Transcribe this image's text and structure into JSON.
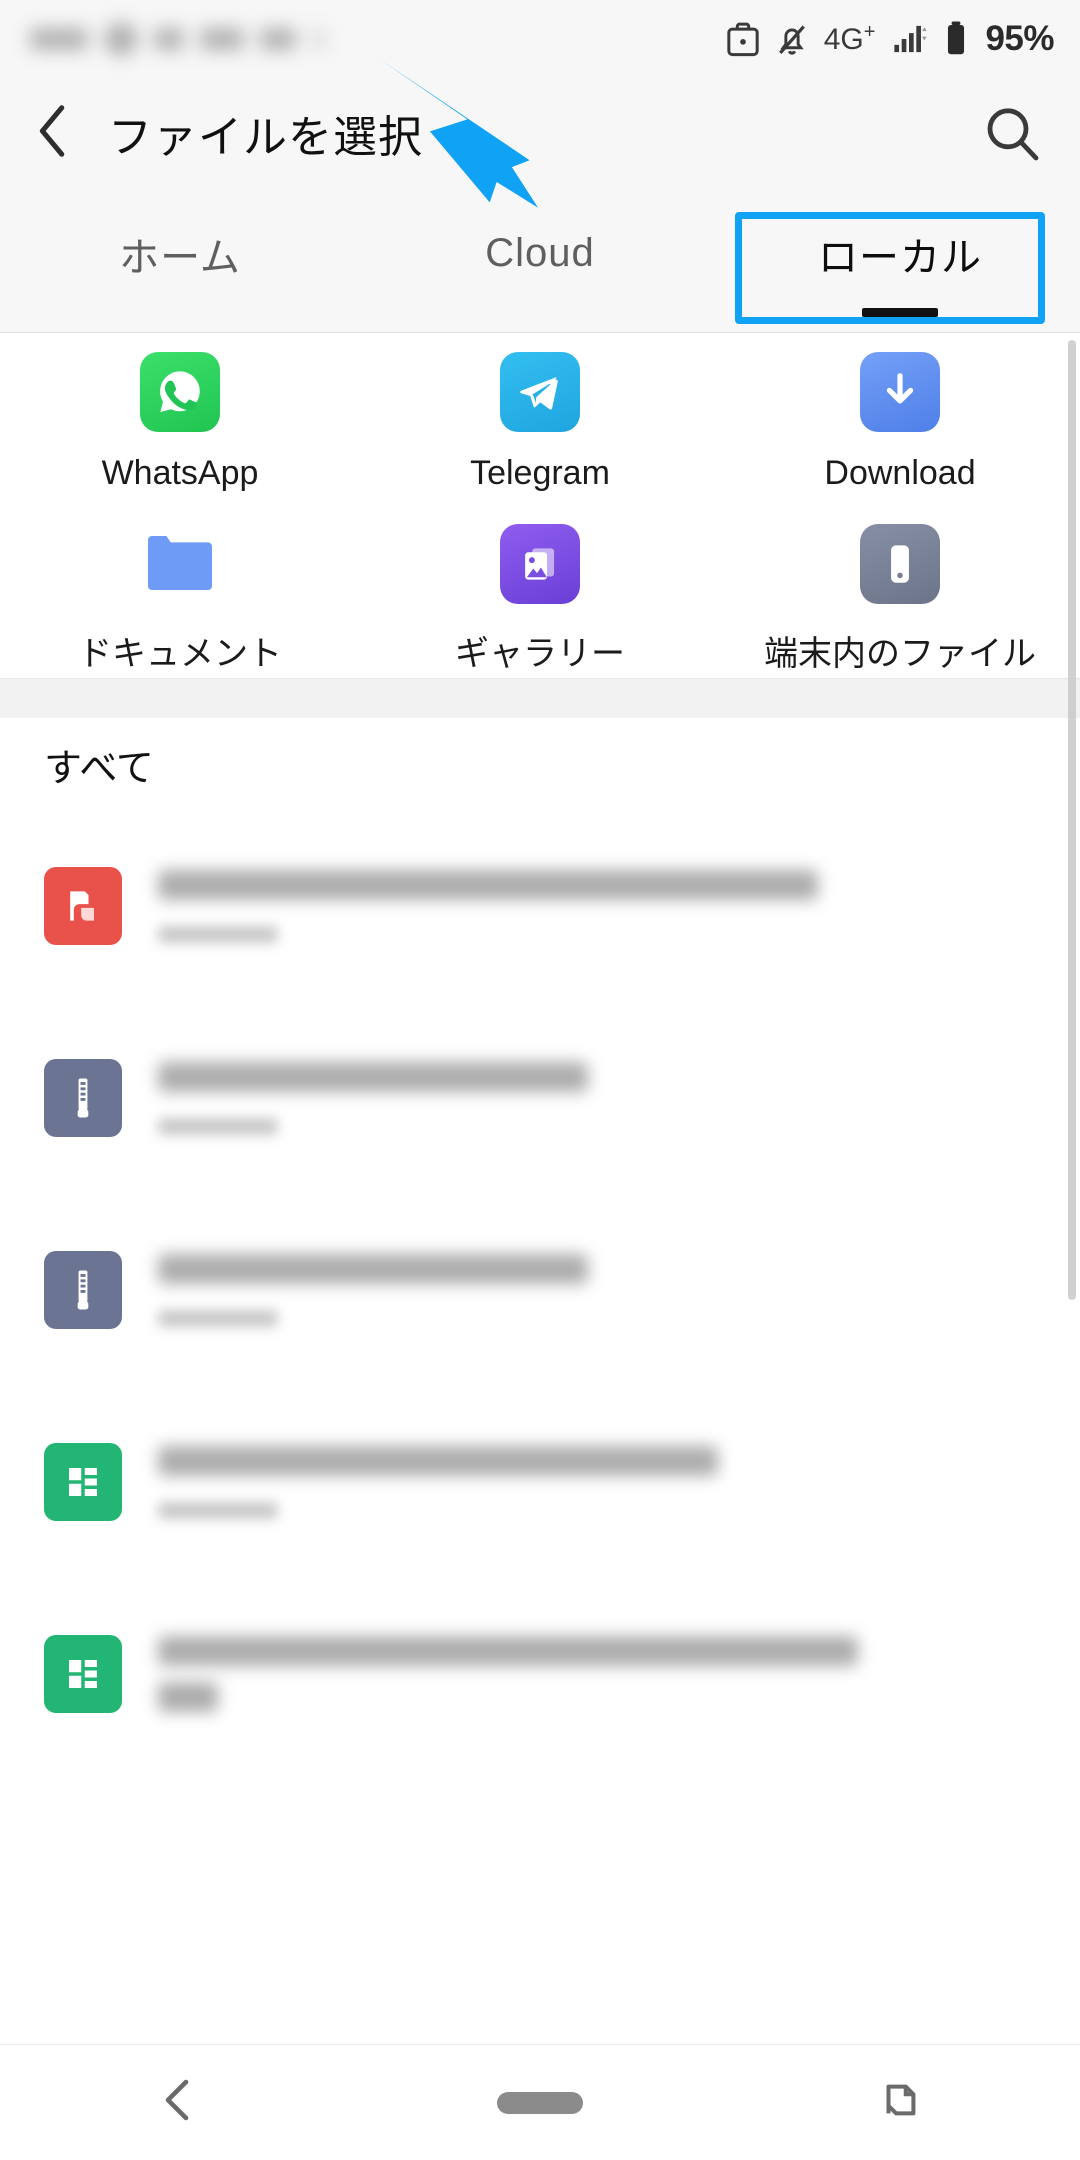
{
  "status_bar": {
    "icons": [
      "work-profile-icon",
      "notifications-muted-icon"
    ],
    "network_label": "4G",
    "network_sup": "+",
    "battery_percent": "95%"
  },
  "app_bar": {
    "back_icon": "chevron-left-icon",
    "title": "ファイルを選択",
    "search_icon": "search-icon"
  },
  "tabs": [
    {
      "label": "ホーム",
      "active": false
    },
    {
      "label": "Cloud",
      "active": false
    },
    {
      "label": "ローカル",
      "active": true
    }
  ],
  "annotation": {
    "highlight_color": "#10a2f5",
    "arrow_color": "#10a2f5",
    "target_tab": "ローカル"
  },
  "shortcuts": [
    {
      "label": "WhatsApp",
      "icon": "whatsapp-icon",
      "color": "#2ed158"
    },
    {
      "label": "Telegram",
      "icon": "telegram-icon",
      "color": "#2aabee"
    },
    {
      "label": "Download",
      "icon": "download-icon",
      "color": "#5b8def"
    },
    {
      "label": "ドキュメント",
      "icon": "folder-icon",
      "color": "#6d9bf5"
    },
    {
      "label": "ギャラリー",
      "icon": "gallery-icon",
      "color": "#7a4fe0"
    },
    {
      "label": "端末内のファイル",
      "icon": "device-storage-icon",
      "color": "#787f96"
    }
  ],
  "section": {
    "title": "すべて"
  },
  "files": [
    {
      "icon": "pdf-file-icon",
      "color": "#e8524a",
      "name_width": 660,
      "two_line": false
    },
    {
      "icon": "zip-file-icon",
      "color": "#6b7492",
      "name_width": 430,
      "two_line": false
    },
    {
      "icon": "zip-file-icon",
      "color": "#6b7492",
      "name_width": 430,
      "two_line": false
    },
    {
      "icon": "spreadsheet-file-icon",
      "color": "#22b573",
      "name_width": 560,
      "two_line": false
    },
    {
      "icon": "spreadsheet-file-icon",
      "color": "#22b573",
      "name_width": 700,
      "two_line": true
    }
  ],
  "nav_bar": {
    "back_icon": "nav-back-icon",
    "home_icon": "nav-home-pill",
    "recents_icon": "nav-recents-icon"
  }
}
